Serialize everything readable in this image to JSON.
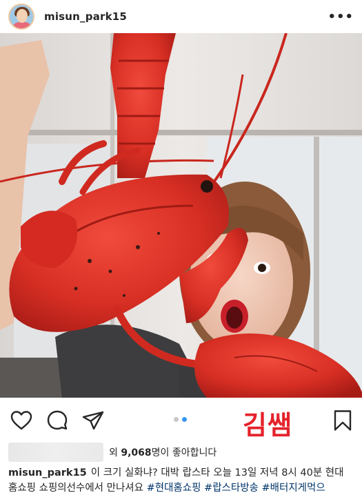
{
  "post": {
    "username": "misun_park15",
    "more_label": "•••"
  },
  "photo": {
    "subject": "woman-holding-red-lobster"
  },
  "actions": {
    "icons": [
      "heart-icon",
      "comment-icon",
      "share-icon",
      "bookmark-icon"
    ],
    "carousel_count": 2,
    "carousel_active": 2,
    "stamp_text": "김쌤",
    "accent_color": "#3897f0",
    "stamp_color": "#e5232c"
  },
  "likes": {
    "prefix": "외 ",
    "count": "9,068",
    "suffix": "명이 좋아합니다"
  },
  "caption": {
    "username": "misun_park15",
    "text": "이 크기 실화냐? 대박 랍스타 오늘 13일 저녁 8시 40분 현대 홈쇼핑 쇼핑의선수에서 만나셔요",
    "hashtags": "#현대홈쇼핑 #랍스타방송 #배터지게먹으"
  }
}
